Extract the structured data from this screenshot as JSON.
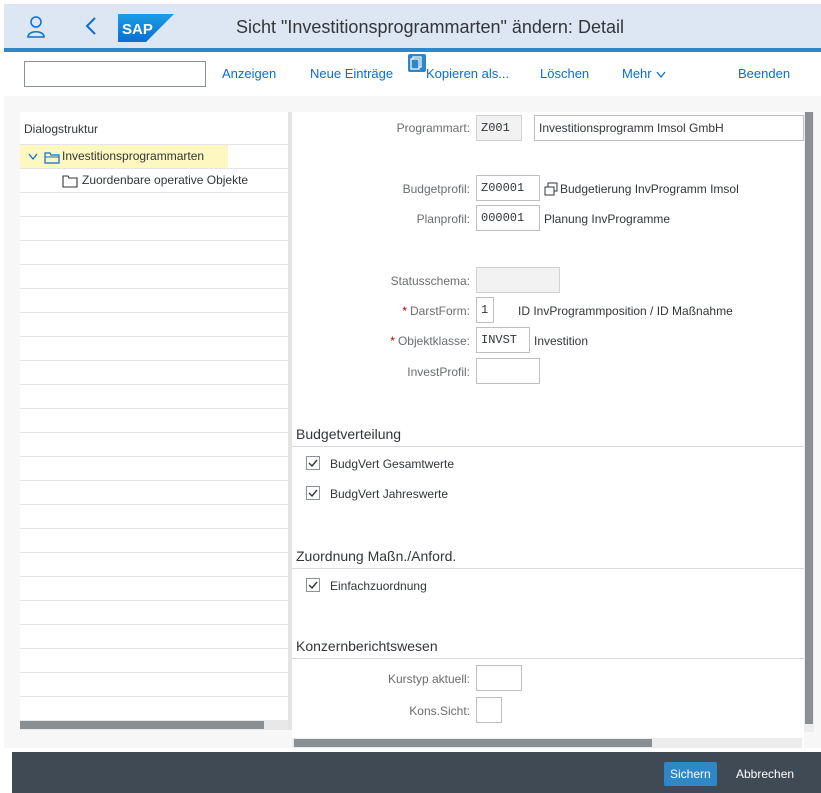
{
  "shell": {
    "title": "Sicht \"Investitionsprogrammarten\" ändern: Detail"
  },
  "toolbar": {
    "command_field_value": "",
    "anzeigen": "Anzeigen",
    "neue_eintraege": "Neue Einträge",
    "kopieren_als": "Kopieren als...",
    "loeschen": "Löschen",
    "mehr": "Mehr",
    "beenden": "Beenden"
  },
  "tree": {
    "title": "Dialogstruktur",
    "items": [
      {
        "label": "Investitionsprogrammarten"
      },
      {
        "label": "Zuordenbare operative Objekte"
      }
    ]
  },
  "form": {
    "programmart": {
      "label": "Programmart:",
      "code": "Z001",
      "text": "Investitionsprogramm Imsol GmbH"
    },
    "budgetprofil": {
      "label": "Budgetprofil:",
      "code": "Z00001",
      "text": "Budgetierung InvProgramm Imsol"
    },
    "planprofil": {
      "label": "Planprofil:",
      "code": "000001",
      "text": "Planung InvProgramme"
    },
    "statusschema": {
      "label": "Statusschema:",
      "value": ""
    },
    "darstform": {
      "label": "DarstForm:",
      "value": "1",
      "text": "ID  InvProgrammposition / ID  Maßnahme"
    },
    "objektklasse": {
      "label": "Objektklasse:",
      "value": "INVST",
      "text": "Investition"
    },
    "investprofil": {
      "label": "InvestProfil:",
      "value": ""
    }
  },
  "sections": {
    "budgetverteilung": {
      "title": "Budgetverteilung",
      "checks": [
        {
          "label": "BudgVert Gesamtwerte",
          "checked": true
        },
        {
          "label": "BudgVert Jahreswerte",
          "checked": true
        }
      ]
    },
    "zuordnung": {
      "title": "Zuordnung Maßn./Anford.",
      "checks": [
        {
          "label": "Einfachzuordnung",
          "checked": true
        }
      ]
    },
    "konzern": {
      "title": "Konzernberichtswesen",
      "kurstyp": {
        "label": "Kurstyp aktuell:",
        "value": ""
      },
      "konssicht": {
        "label": "Kons.Sicht:",
        "value": ""
      }
    }
  },
  "footer": {
    "sichern": "Sichern",
    "abbrechen": "Abbrechen"
  },
  "colors": {
    "shell_bg": "#dde7f3",
    "accent": "#2d87c8",
    "footer_bg": "#404a54",
    "selection_bg": "#fdf7c0"
  }
}
